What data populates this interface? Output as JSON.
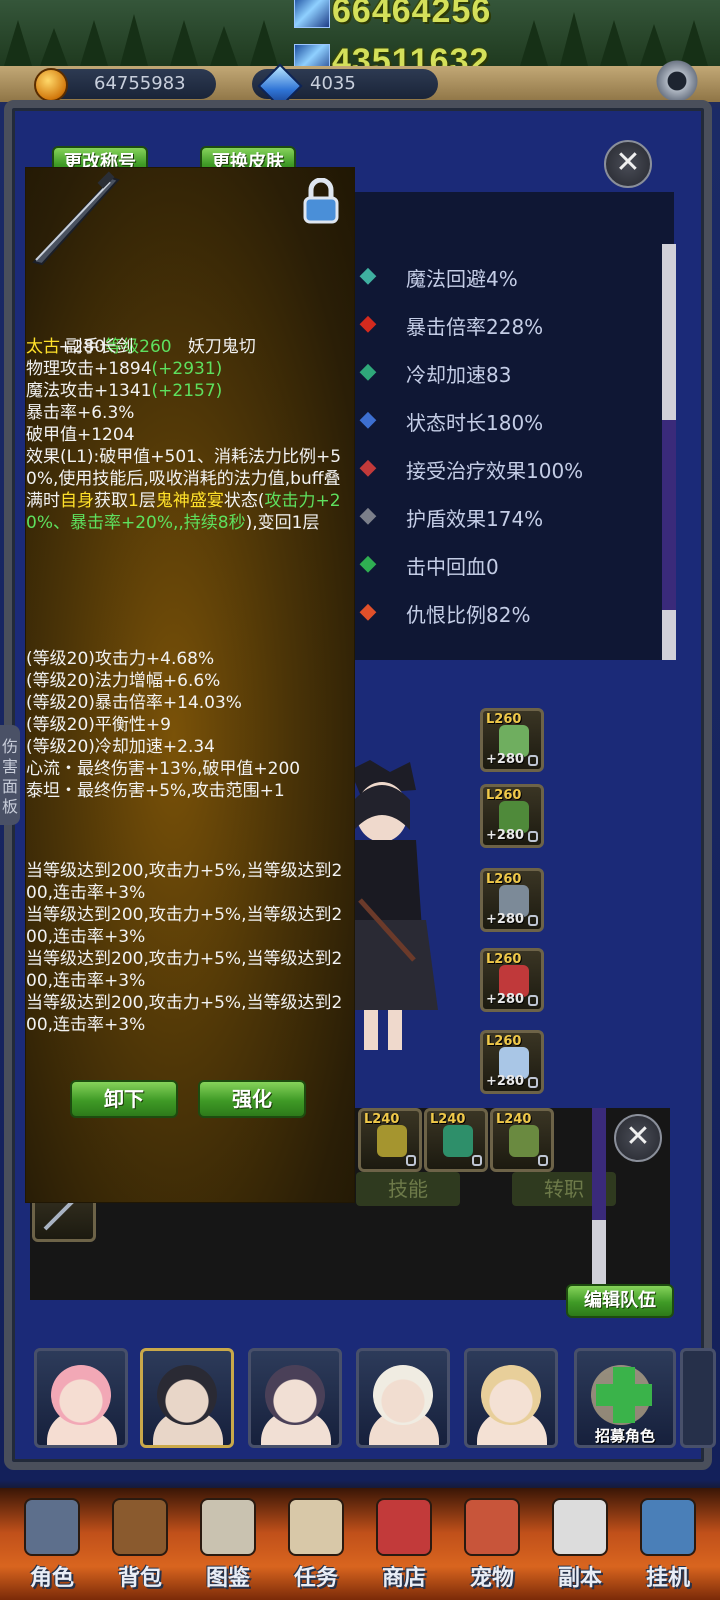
{
  "header": {
    "power_primary": "66464256",
    "power_secondary": "43511632",
    "gold": "64755983",
    "gems": "4035"
  },
  "panel": {
    "rename_button": "更改称号",
    "skin_button": "更换皮肤",
    "side_tab": "伤害面板"
  },
  "stats": [
    {
      "label": "魔法回避4%",
      "icon": "wind-dodge-icon",
      "color": "#3fb0a0"
    },
    {
      "label": "暴击倍率228%",
      "icon": "crit-burst-icon",
      "color": "#d42a1e"
    },
    {
      "label": "冷却加速83",
      "icon": "hourglass-icon",
      "color": "#2fa87a"
    },
    {
      "label": "状态时长180%",
      "icon": "status-duration-icon",
      "color": "#3d6fd0"
    },
    {
      "label": "接受治疗效果100%",
      "icon": "heal-cross-icon",
      "color": "#c23a3a"
    },
    {
      "label": "护盾效果174%",
      "icon": "shield-orb-icon",
      "color": "#7b7f8a"
    },
    {
      "label": "击中回血0",
      "icon": "lifesteal-drop-icon",
      "color": "#2fae52"
    },
    {
      "label": "仇恨比例82%",
      "icon": "aggro-demon-icon",
      "color": "#e0502a"
    }
  ],
  "equip_slots": [
    {
      "level": "L260",
      "plus": "+280",
      "art_color": "#6fae5f"
    },
    {
      "level": "L260",
      "plus": "+280",
      "art_color": "#4f8a3a"
    },
    {
      "level": "L260",
      "plus": "+280",
      "art_color": "#7c8a98"
    },
    {
      "level": "L260",
      "plus": "+280",
      "art_color": "#c0393a"
    },
    {
      "level": "L260",
      "plus": "+280",
      "art_color": "#a9c6e6"
    }
  ],
  "lower": {
    "slots": [
      {
        "level": "L240",
        "art_color": "#a5952f"
      },
      {
        "level": "L240",
        "art_color": "#2e8f6a"
      },
      {
        "level": "L240",
        "art_color": "#6a8a40"
      }
    ],
    "skill_button": "技能",
    "transfer_button": "转职",
    "edit_team_button": "编辑队伍"
  },
  "tooltip": {
    "header_plus": "+280",
    "header_level": "等级260",
    "item_name": "妖刀鬼切",
    "rarity": "太古",
    "item_type": "副手长剑",
    "phys_label": "物理攻击+1894",
    "phys_bonus": "(+2931)",
    "magic_label": "魔法攻击+1341",
    "magic_bonus": "(+2157)",
    "crit_rate": "暴击率+6.3%",
    "armor_break": "破甲值+1204",
    "effect_1": "效果(L1):破甲值+501、消耗法力比例+50%,使用技能后,吸收消耗的法力值,buff叠满时",
    "effect_self": "自身",
    "effect_2": "获取",
    "effect_stack": "1",
    "effect_3": "层",
    "effect_buff": "鬼神盛宴",
    "effect_4": "状态(",
    "effect_green": "攻击力+20%、暴击率+20%,,持续8秒",
    "effect_5": "),变回1层",
    "sub_1": "(等级20)攻击力+4.68%",
    "sub_2": "(等级20)法力增幅+6.6%",
    "sub_3": "(等级20)暴击倍率+14.03%",
    "sub_4": "(等级20)平衡性+9",
    "sub_5": "(等级20)冷却加速+2.34",
    "set_1": "心流・最终伤害+13%,破甲值+200",
    "set_2": "泰坦・最终伤害+5%,攻击范围+1",
    "bonus_1": "当等级达到200,攻击力+5%,当等级达到200,连击率+3%",
    "bonus_2": "当等级达到200,攻击力+5%,当等级达到200,连击率+3%",
    "bonus_3": "当等级达到200,攻击力+5%,当等级达到200,连击率+3%",
    "bonus_4": "当等级达到200,攻击力+5%,当等级达到200,连击率+3%",
    "unequip_button": "卸下",
    "enhance_button": "强化"
  },
  "roster": [
    {
      "name": "pink-hair",
      "hair": "#f2a8b6",
      "skin": "#f5ddd2"
    },
    {
      "name": "cat-hood",
      "hair": "#2a2a34",
      "skin": "#e8d6c8",
      "selected": true
    },
    {
      "name": "dark-bob",
      "hair": "#4a4058",
      "skin": "#f1dfd4"
    },
    {
      "name": "bandaged",
      "hair": "#f0ece2",
      "skin": "#f1ddd0"
    },
    {
      "name": "blonde-bun",
      "hair": "#e8cf9a",
      "skin": "#f4e1d4"
    }
  ],
  "recruit_label": "招募角色",
  "nav": [
    {
      "label": "角色",
      "icon": "helmet-icon",
      "color": "#5d6f8c"
    },
    {
      "label": "背包",
      "icon": "backpack-icon",
      "color": "#8a5a2e"
    },
    {
      "label": "图鉴",
      "icon": "book-icon",
      "color": "#c9c2b0"
    },
    {
      "label": "任务",
      "icon": "scroll-icon",
      "color": "#d8c8a8"
    },
    {
      "label": "商店",
      "icon": "shop-icon",
      "color": "#c23a3a"
    },
    {
      "label": "宠物",
      "icon": "meat-icon",
      "color": "#c8553a"
    },
    {
      "label": "副本",
      "icon": "skull-icon",
      "color": "#dcdcdc"
    },
    {
      "label": "挂机",
      "icon": "calendar-icon",
      "color": "#4a7fb8"
    }
  ],
  "colors": {
    "power": "#d4e05a",
    "tooltip_yellow": "#ffe12a",
    "tooltip_green": "#5ee05e",
    "tooltip_orange": "#ff9c1a"
  }
}
